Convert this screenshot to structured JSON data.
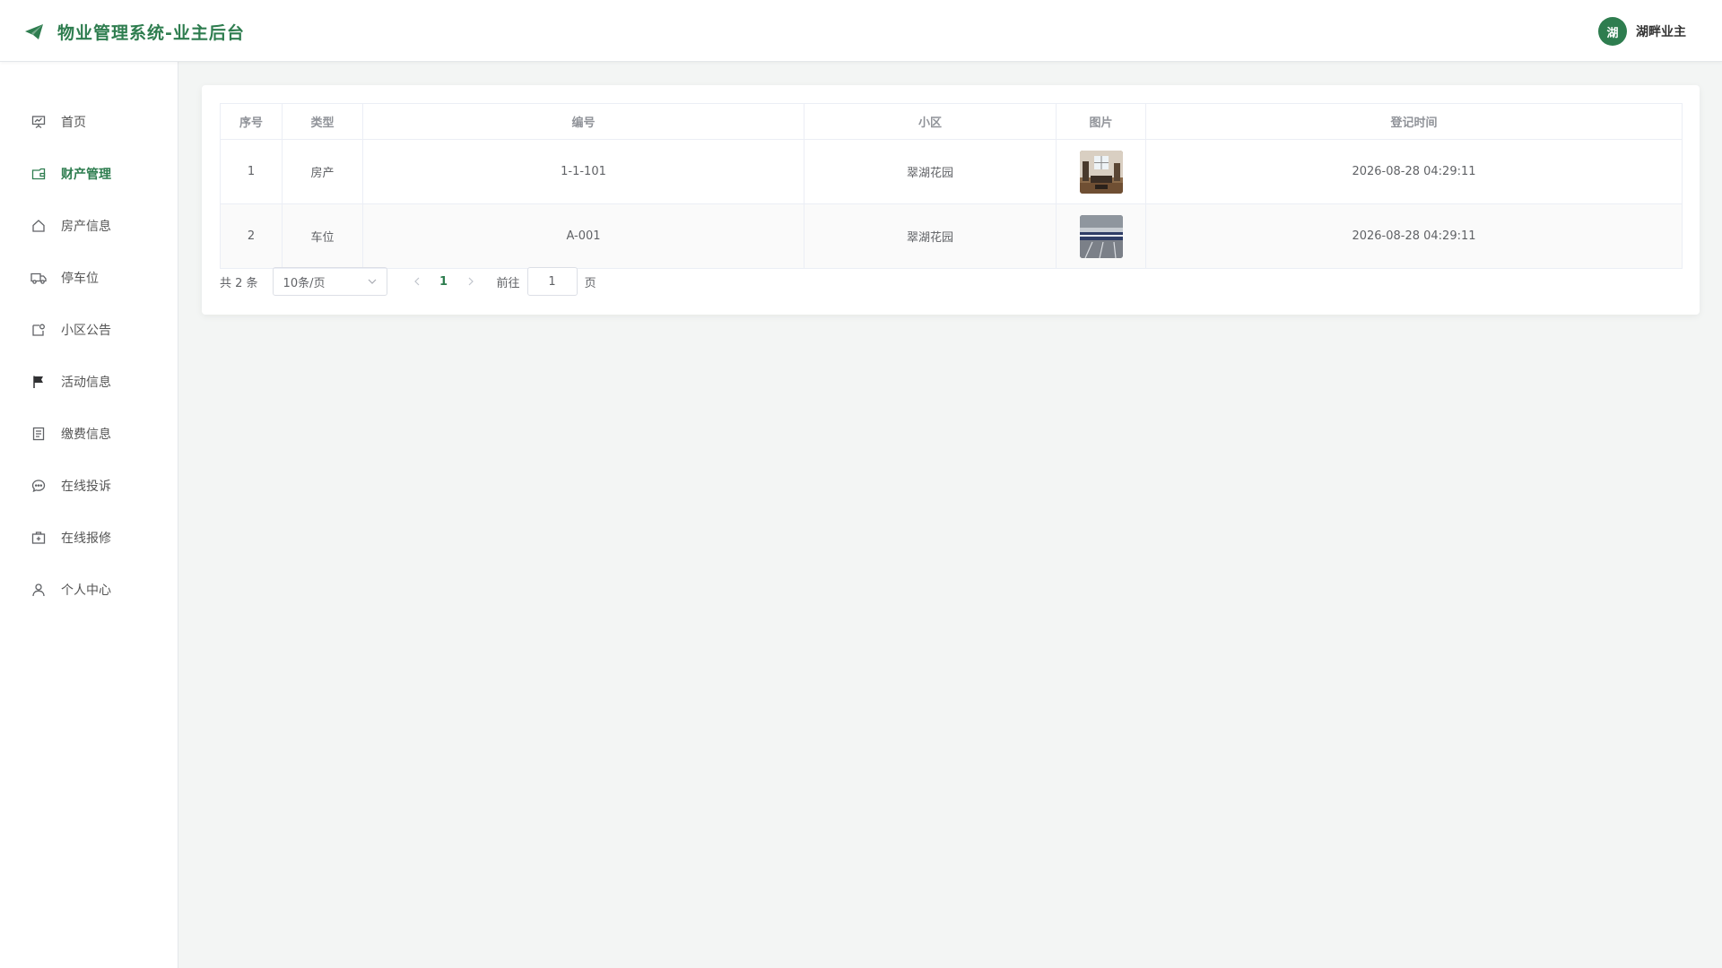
{
  "header": {
    "title": "物业管理系统-业主后台",
    "avatar_char": "湖",
    "username": "湖畔业主"
  },
  "sidebar": {
    "items": [
      {
        "label": "首页",
        "icon": "presentation-board-icon"
      },
      {
        "label": "财产管理",
        "icon": "wallet-icon",
        "active": true
      },
      {
        "label": "房产信息",
        "icon": "house-icon"
      },
      {
        "label": "停车位",
        "icon": "truck-icon"
      },
      {
        "label": "小区公告",
        "icon": "notice-icon"
      },
      {
        "label": "活动信息",
        "icon": "flag-icon"
      },
      {
        "label": "缴费信息",
        "icon": "document-icon"
      },
      {
        "label": "在线投诉",
        "icon": "chat-bubble-icon"
      },
      {
        "label": "在线报修",
        "icon": "first-aid-kit-icon"
      },
      {
        "label": "个人中心",
        "icon": "user-icon"
      }
    ]
  },
  "table": {
    "columns": [
      "序号",
      "类型",
      "编号",
      "小区",
      "图片",
      "登记时间"
    ],
    "rows": [
      {
        "index": "1",
        "type": "房产",
        "code": "1-1-101",
        "community": "翠湖花园",
        "image": "room-interior-photo",
        "time": "2026-08-28 04:29:11"
      },
      {
        "index": "2",
        "type": "车位",
        "code": "A-001",
        "community": "翠湖花园",
        "image": "parking-space-photo",
        "time": "2026-08-28 04:29:11"
      }
    ]
  },
  "pagination": {
    "total": "共 2 条",
    "page_size": "10条/页",
    "current_page": "1",
    "goto_label": "前往",
    "goto_value": "1",
    "page_suffix": "页"
  },
  "colors": {
    "accent": "#2e7d4f",
    "background": "#f3f5f4"
  }
}
